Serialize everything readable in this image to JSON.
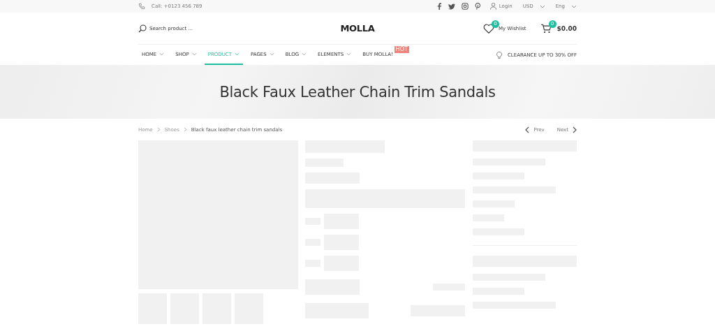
{
  "top_bar": {
    "phone": "Call: +0123 456 789",
    "login": "Login",
    "currency": "USD",
    "language": "Eng"
  },
  "header": {
    "search": {
      "placeholder": "Search product ..."
    },
    "logo": "MOLLA",
    "wishlist": {
      "label": "My Wishlist",
      "count": "0"
    },
    "cart": {
      "count": "0",
      "total": "$0.00"
    }
  },
  "nav": {
    "items": [
      {
        "label": "HOME",
        "selected": false
      },
      {
        "label": "SHOP",
        "selected": false
      },
      {
        "label": "PRODUCT",
        "selected": true
      },
      {
        "label": "PAGES",
        "selected": false
      },
      {
        "label": "BLOG",
        "selected": false
      },
      {
        "label": "ELEMENTS",
        "selected": false
      }
    ],
    "buy": {
      "label": "BUY MOLLA!",
      "badge": "HOT"
    },
    "promo": "CLEARANCE UP TO 30% OFF"
  },
  "page_title": "Black Faux Leather Chain Trim Sandals",
  "breadcrumb": [
    "Home",
    "Shoes",
    "Black faux leather chain trim sandals"
  ],
  "pager": {
    "prev": "Prev",
    "next": "Next"
  }
}
